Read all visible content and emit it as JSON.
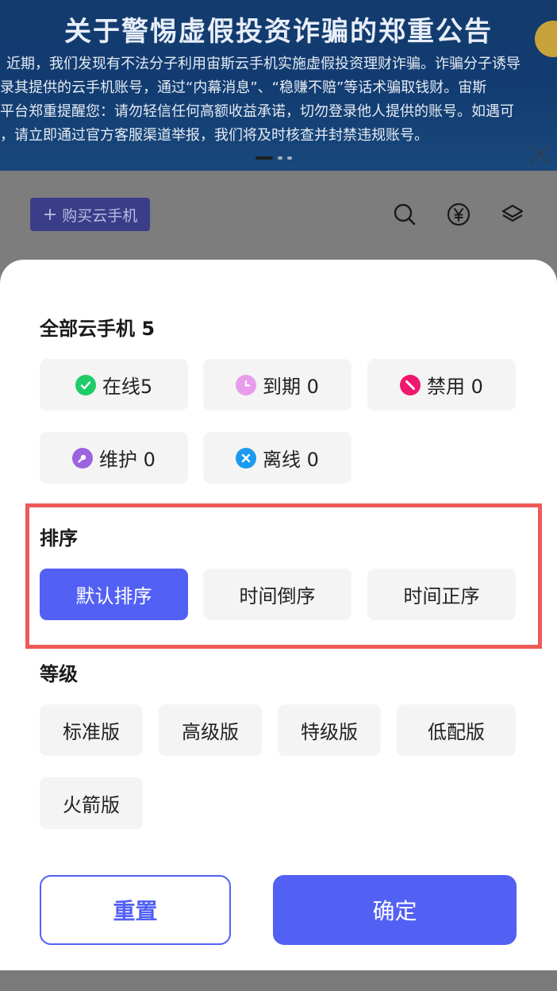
{
  "banner": {
    "title": "关于警惕虚假投资诈骗的郑重公告",
    "lines": [
      "近期，我们发现有不法分子利用宙斯云手机实施虚假投资理财诈骗。诈骗分子诱导",
      "录其提供的云手机账号，通过“内幕消息”、“稳赚不赔”等话术骗取钱财。宙斯",
      "平台郑重提醒您：请勿轻信任何高额收益承诺，切勿登录他人提供的账号。如遇可",
      "，请立即通过官方客服渠道举报，我们将及时核查并封禁违规账号。"
    ]
  },
  "toolbar": {
    "buy_label": "购买云手机"
  },
  "filter": {
    "all_title": "全部云手机 5",
    "status": [
      {
        "label": "在线5",
        "icon": "check-circle-icon",
        "color": "#1fcc6a"
      },
      {
        "label": "到期 0",
        "icon": "clock-icon",
        "color": "#e89cec"
      },
      {
        "label": "禁用 0",
        "icon": "ban-icon",
        "color": "#f0176f"
      },
      {
        "label": "维护 0",
        "icon": "wrench-icon",
        "color": "#9b63e0"
      },
      {
        "label": "离线 0",
        "icon": "x-circle-icon",
        "color": "#1b9af0"
      }
    ],
    "sort_title": "排序",
    "sort": [
      {
        "label": "默认排序",
        "selected": true
      },
      {
        "label": "时间倒序",
        "selected": false
      },
      {
        "label": "时间正序",
        "selected": false
      }
    ],
    "level_title": "等级",
    "levels": [
      "标准版",
      "高级版",
      "特级版",
      "低配版",
      "火箭版"
    ],
    "reset_label": "重置",
    "confirm_label": "确定"
  },
  "colors": {
    "accent": "#5260f4",
    "highlight": "#ee5a58"
  }
}
